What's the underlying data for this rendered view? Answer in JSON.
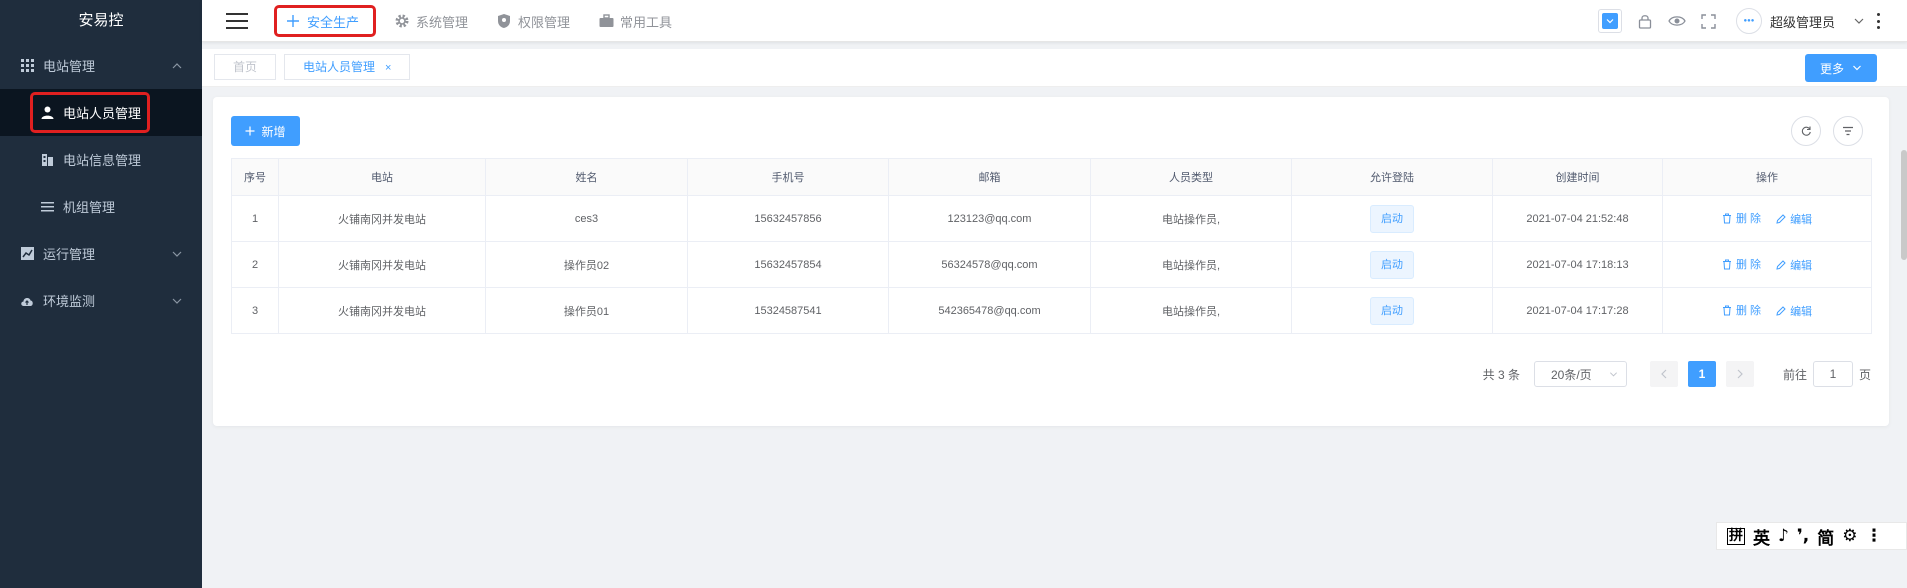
{
  "app": {
    "title": "安易控"
  },
  "sidebar": {
    "groups": [
      {
        "label": "电站管理",
        "icon": "grid-icon",
        "expanded": true,
        "items": [
          {
            "label": "电站人员管理",
            "icon": "user-icon",
            "active": true
          },
          {
            "label": "电站信息管理",
            "icon": "building-icon"
          },
          {
            "label": "机组管理",
            "icon": "list-icon"
          }
        ]
      },
      {
        "label": "运行管理",
        "icon": "chart-icon",
        "expanded": false
      },
      {
        "label": "环境监测",
        "icon": "cloud-icon",
        "expanded": false
      }
    ]
  },
  "header": {
    "topnav": [
      {
        "label": "安全生产",
        "icon": "plus-icon",
        "active": true
      },
      {
        "label": "系统管理",
        "icon": "gear-icon"
      },
      {
        "label": "权限管理",
        "icon": "shield-icon"
      },
      {
        "label": "常用工具",
        "icon": "briefcase-icon"
      }
    ],
    "user": {
      "name": "超级管理员"
    },
    "accent": "#409eff"
  },
  "tags": {
    "home": "首页",
    "current": "电站人员管理",
    "close": "×",
    "more": "更多"
  },
  "toolbar": {
    "add": "新增"
  },
  "table": {
    "columns": [
      "序号",
      "电站",
      "姓名",
      "手机号",
      "邮箱",
      "人员类型",
      "允许登陆",
      "创建时间",
      "操作"
    ],
    "rows": [
      {
        "index": "1",
        "station": "火铺南冈并发电站",
        "name": "ces3",
        "phone": "15632457856",
        "email": "123123@qq.com",
        "type": "电站操作员,",
        "login": "启动",
        "created": "2021-07-04 21:52:48"
      },
      {
        "index": "2",
        "station": "火铺南冈并发电站",
        "name": "操作员02",
        "phone": "15632457854",
        "email": "56324578@qq.com",
        "type": "电站操作员,",
        "login": "启动",
        "created": "2021-07-04 17:18:13"
      },
      {
        "index": "3",
        "station": "火铺南冈并发电站",
        "name": "操作员01",
        "phone": "15324587541",
        "email": "542365478@qq.com",
        "type": "电站操作员,",
        "login": "启动",
        "created": "2021-07-04 17:17:28"
      }
    ],
    "actions": {
      "delete": "删 除",
      "edit": "编辑"
    }
  },
  "pagination": {
    "total": "共 3 条",
    "page_size": "20条/页",
    "current_page": "1",
    "goto_prefix": "前往",
    "goto_value": "1",
    "goto_suffix": "页"
  },
  "ime": {
    "glyphs": [
      "拼",
      "英",
      "♪",
      "❜,",
      "简",
      "⚙",
      "⋮"
    ]
  }
}
